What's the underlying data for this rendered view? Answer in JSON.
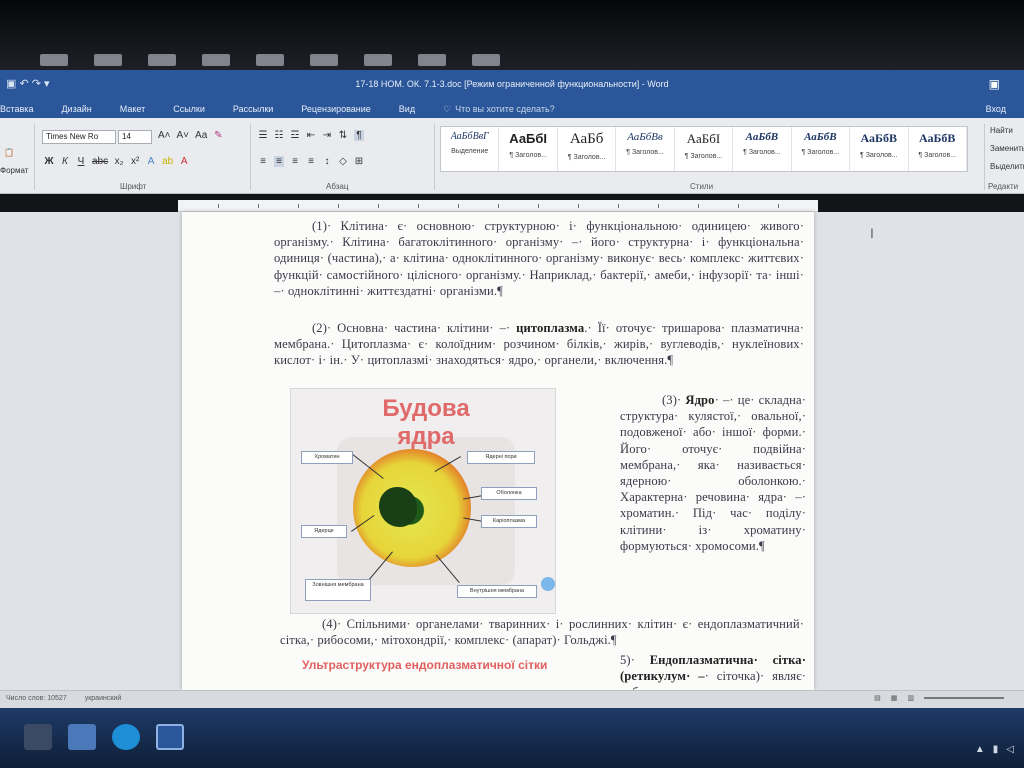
{
  "window": {
    "title": "17-18 НОМ. ОК. 7.1-3.doc [Режим ограниченной функциональности] - Word",
    "quick_access": "▣ ↶ ↷ ▾"
  },
  "menu": {
    "tabs": [
      "Вставка",
      "Дизайн",
      "Макет",
      "Ссылки",
      "Рассылки",
      "Рецензирование",
      "Вид"
    ],
    "tell_me": "Что вы хотите сделать?",
    "login": "Вход"
  },
  "ribbon": {
    "font_name": "Times New Ro",
    "font_size": "14",
    "format_painter": "Формат",
    "group_font": "Шрифт",
    "group_paragraph": "Абзац",
    "group_styles": "Стили",
    "group_editing": "Редакти",
    "find": "Найти",
    "replace": "Заменить",
    "select": "Выделить",
    "styles": [
      {
        "sample": "АаБбВвГ",
        "name": "Выделение"
      },
      {
        "sample": "АаБбІ",
        "name": "¶ Заголов..."
      },
      {
        "sample": "АаБб",
        "name": "¶ Заголов..."
      },
      {
        "sample": "АаБбВв",
        "name": "¶ Заголов..."
      },
      {
        "sample": "АаБбІ",
        "name": "¶ Заголов..."
      },
      {
        "sample": "АаБбВ",
        "name": "¶ Заголов..."
      },
      {
        "sample": "АаБбВ",
        "name": "¶ Заголов..."
      },
      {
        "sample": "АаБбВ",
        "name": "¶ Заголов..."
      },
      {
        "sample": "АаБбВ",
        "name": "¶ Заголов..."
      }
    ]
  },
  "document": {
    "para1": "(1)· Клітина· є· основною· структурною· і· функціональною· одиницею· живого· організму.· Клітина· багатоклітинного· організму· –· його· структурна· і· функціональна· одиниця· (частина),· а· клітина· одноклітинного· організму· виконує· весь· комплекс· життєвих· функцій· самостійного· цілісного· організму.· Наприклад,· бактерії,· амеби,· інфузорії· та· інші· –· одноклітинні· життєздатні· організми.¶",
    "para2_a": "(2)· Основна· частина· клітини· –· ",
    "para2_bold": "цитоплазма",
    "para2_b": ".· Її· оточує· тришарова· плазматична· мембрана.· Цитоплазма· є· колоїдним· розчином· білків,· жирів,· вуглеводів,· нуклеїнових· кислот· і· ін.· У· цитоплазмі· знаходяться· ядро,· органели,· включення.¶",
    "para3_a": "(3)· ",
    "para3_bold": "Ядро",
    "para3_b": "· –· це· складна· структура· кулястої,· овальної,· подовженої· або· іншої· форми.· Його· оточує· подвійна· мембрана,· яка· називається· ядерною· оболонкою.· Характерна· речовина· ядра· –· хроматин.· Під· час· поділу· клітини· із· хроматину· формуються· хромосоми.¶",
    "para4": "(4)· Спільними· органелами· тваринних· і· рослинних· клітин· є· ендоплазматичний· сітка,· рибосоми,· мітохондрії,· комплекс· (апарат)· Гольджі.¶",
    "para5_a": "5)· ",
    "para5_bold": "Ендоплазматична· сітка· (ретикулум· –",
    "para5_b": "· сіточка)· являє· собою·",
    "subhead": "Ультраструктура ендоплазматичної сітки",
    "figure": {
      "title": "Будова ядра",
      "labels": {
        "chromatin": "Хроматин",
        "pores": "Ядерні пори",
        "envelope": "Оболонка",
        "karyoplasm": "Каріоплазма",
        "nucleolus": "Ядерце",
        "outer_membrane": "Зовнішня мембрана",
        "inner_membrane": "Внутрішня мембрана"
      }
    }
  },
  "status": {
    "words": "Число слов: 10527",
    "lang": "украинский"
  }
}
